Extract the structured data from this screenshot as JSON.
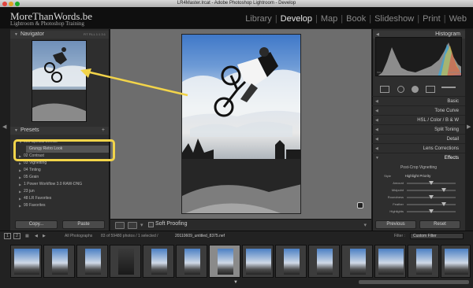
{
  "window": {
    "title": "LR4Master.lrcat - Adobe Photoshop Lightroom - Develop"
  },
  "identity_plate": {
    "title": "MoreThanWords.be",
    "subtitle": "Lightroom & Photoshop Training"
  },
  "modules": [
    {
      "label": "Library",
      "active": false
    },
    {
      "label": "Develop",
      "active": true
    },
    {
      "label": "Map",
      "active": false
    },
    {
      "label": "Book",
      "active": false
    },
    {
      "label": "Slideshow",
      "active": false
    },
    {
      "label": "Print",
      "active": false
    },
    {
      "label": "Web",
      "active": false
    }
  ],
  "navigator": {
    "title": "Navigator",
    "options": "FIT  FILL  1:1  3:1"
  },
  "presets": {
    "title": "Presets",
    "items": [
      {
        "label": "000 Special Effects",
        "type": "folder"
      },
      {
        "label": "Grungy Retro Look",
        "type": "preset"
      },
      {
        "label": "02 Contrast",
        "type": "folder"
      },
      {
        "label": "03 Vignetting",
        "type": "folder"
      },
      {
        "label": "04 Tinting",
        "type": "folder"
      },
      {
        "label": "05 Grain",
        "type": "folder"
      },
      {
        "label": "1 Power Workflow 3.0 RAW-DNG",
        "type": "folder"
      },
      {
        "label": "23 jun",
        "type": "folder"
      },
      {
        "label": "48 LR Favorites",
        "type": "folder"
      },
      {
        "label": "99 Favorites",
        "type": "folder"
      }
    ]
  },
  "left_buttons": {
    "copy": "Copy...",
    "paste": "Paste"
  },
  "toolbar": {
    "soft_proofing": "Soft Proofing"
  },
  "histogram": {
    "title": "Histogram",
    "info": [
      "ISO 400",
      "50 mm",
      "f / 7.1",
      "1/1250 sec"
    ]
  },
  "right_sections": [
    {
      "label": "Basic",
      "active": false
    },
    {
      "label": "Tone Curve",
      "active": false
    },
    {
      "label": "HSL  /  Color  /  B & W",
      "active": false
    },
    {
      "label": "Split Toning",
      "active": false
    },
    {
      "label": "Detail",
      "active": false
    },
    {
      "label": "Lens Corrections",
      "active": false
    },
    {
      "label": "Effects",
      "active": true
    }
  ],
  "effects": {
    "vignette_title": "Post-Crop Vignetting",
    "style_label": "Style",
    "style_value": "Highlight Priority",
    "sliders": [
      {
        "label": "Amount",
        "value": 0
      },
      {
        "label": "Midpoint",
        "value": 50
      },
      {
        "label": "Roundness",
        "value": 0
      },
      {
        "label": "Feather",
        "value": 50
      },
      {
        "label": "Highlights",
        "value": 0
      }
    ]
  },
  "right_buttons": {
    "previous": "Previous",
    "reset": "Reset"
  },
  "filmstrip": {
    "source": "All Photographs",
    "counts": "83 of 59480 photos / 1 selected /",
    "filename": "20110609_untitled_8375.nef",
    "filter_label": "Filter :",
    "filter_value": "Custom Filter"
  },
  "colors": {
    "accent_highlight": "#f2d44a",
    "panel_bg": "#2e2e2e",
    "center_bg": "#6d6d6d"
  }
}
